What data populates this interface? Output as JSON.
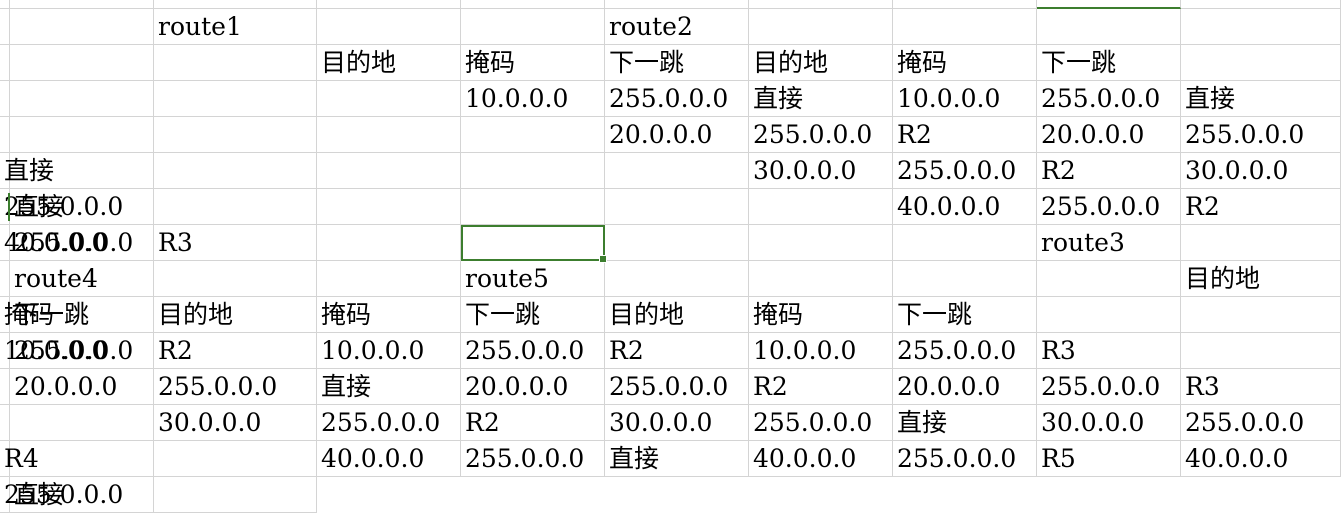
{
  "sheet": {
    "rows": [
      [
        "route1",
        "",
        "",
        "route2",
        "",
        "",
        "",
        "",
        ""
      ],
      [
        "目的地",
        "掩码",
        "下一跳",
        "目的地",
        "掩码",
        "下一跳",
        "",
        "",
        ""
      ],
      [
        "10.0.0.0",
        "255.0.0.0",
        "直接",
        "10.0.0.0",
        "255.0.0.0",
        "直接",
        "",
        "",
        ""
      ],
      [
        "20.0.0.0",
        "255.0.0.0",
        "R2",
        "20.0.0.0",
        "255.0.0.0",
        "直接",
        "",
        "",
        ""
      ],
      [
        "30.0.0.0",
        "255.0.0.0",
        "R2",
        "30.0.0.0",
        "255.0.0.0",
        "直接",
        "",
        "",
        ""
      ],
      [
        "40.0.0.0",
        "255.0.0.0",
        "R2",
        "40.0.0.0",
        "255.0.0.0",
        "R3",
        "",
        "",
        ""
      ],
      [
        "route3",
        "",
        "",
        "route4",
        "",
        "",
        "route5",
        "",
        ""
      ],
      [
        "目的地",
        "掩码",
        "下一跳",
        "目的地",
        "掩码",
        "下一跳",
        "目的地",
        "掩码",
        "下一跳"
      ],
      [
        "10.0.0.0",
        "255.0.0.0",
        "R2",
        "10.0.0.0",
        "255.0.0.0",
        "R2",
        "10.0.0.0",
        "255.0.0.0",
        "R3"
      ],
      [
        "20.0.0.0",
        "255.0.0.0",
        "直接",
        "20.0.0.0",
        "255.0.0.0",
        "R2",
        "20.0.0.0",
        "255.0.0.0",
        "R3"
      ],
      [
        "30.0.0.0",
        "255.0.0.0",
        "R2",
        "30.0.0.0",
        "255.0.0.0",
        "直接",
        "30.0.0.0",
        "255.0.0.0",
        "R4"
      ],
      [
        "40.0.0.0",
        "255.0.0.0",
        "直接",
        "40.0.0.0",
        "255.0.0.0",
        "R5",
        "40.0.0.0",
        "255.0.0.0",
        "直接"
      ]
    ],
    "selected_cell": {
      "row": 5,
      "col": 7
    },
    "colors": {
      "gridline": "#d4d4d4",
      "selection": "#3c7e2e",
      "text": "#000000"
    }
  }
}
